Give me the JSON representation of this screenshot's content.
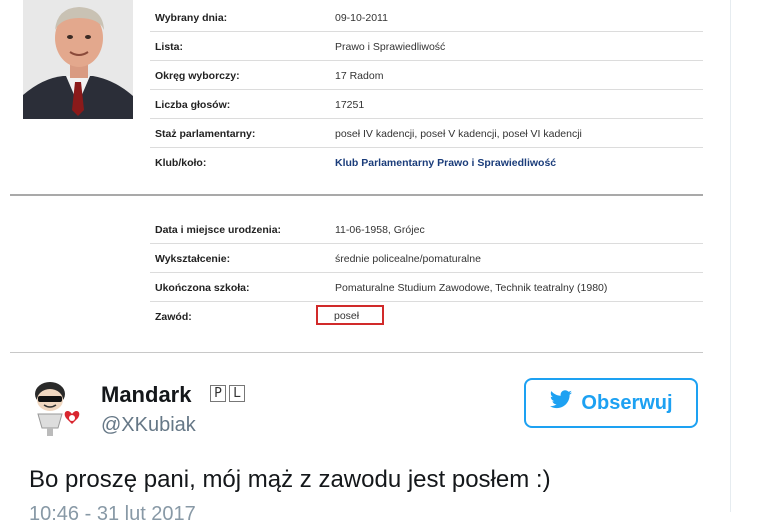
{
  "profile": {
    "rows_top": [
      {
        "label": "Wybrany dnia:",
        "value": "09-10-2011"
      },
      {
        "label": "Lista:",
        "value": "Prawo i Sprawiedliwość"
      },
      {
        "label": "Okręg wyborczy:",
        "value": "17  Radom"
      },
      {
        "label": "Liczba głosów:",
        "value": "17251"
      },
      {
        "label": "Staż parlamentarny:",
        "value": "poseł IV kadencji, poseł V kadencji, poseł VI kadencji"
      },
      {
        "label": "Klub/koło:",
        "value": "Klub Parlamentarny Prawo i Sprawiedliwość"
      }
    ],
    "rows_bottom": [
      {
        "label": "Data i miejsce urodzenia:",
        "value": "11-06-1958, Grójec"
      },
      {
        "label": "Wykształcenie:",
        "value": "średnie policealne/pomaturalne"
      },
      {
        "label": "Ukończona szkoła:",
        "value": "Pomaturalne Studium Zawodowe, Technik teatralny (1980)"
      },
      {
        "label": "Zawód:",
        "value": "poseł"
      }
    ]
  },
  "tweet": {
    "author_name": "Mandark",
    "flag_letters": [
      "P",
      "L"
    ],
    "handle": "@XKubiak",
    "follow_label": "Obserwuj",
    "text": "Bo proszę pani, mój mąż z zawodu jest posłem :)",
    "timestamp": "10:46 - 31 lut 2017"
  },
  "colors": {
    "twitter_blue": "#1da1f2",
    "highlight_red": "#d12a2a",
    "link_blue": "#1a3c7a"
  }
}
